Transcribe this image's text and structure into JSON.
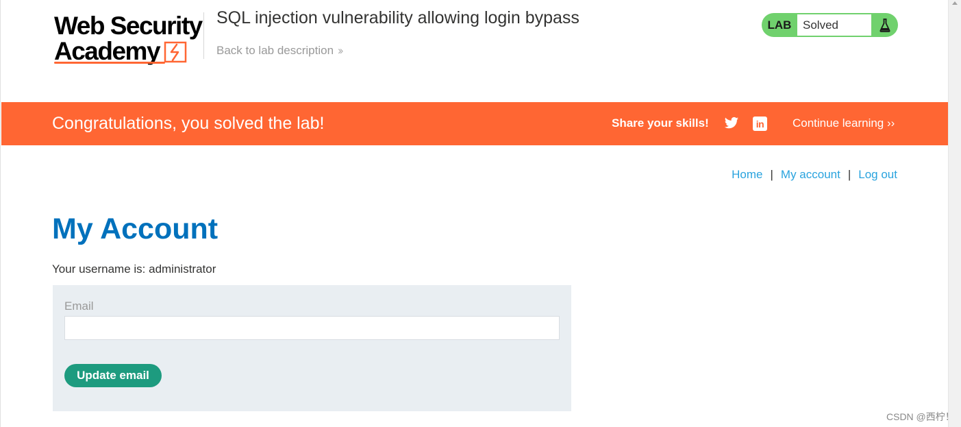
{
  "header": {
    "logo_line1": "Web Security",
    "logo_line2": "Academy",
    "lab_title": "SQL injection vulnerability allowing login bypass",
    "back_link": "Back to lab description",
    "lab_status": {
      "tag": "LAB",
      "state": "Solved"
    }
  },
  "banner": {
    "message": "Congratulations, you solved the lab!",
    "share": "Share your skills!",
    "continue": "Continue learning",
    "icons": [
      "twitter-icon",
      "linkedin-icon"
    ],
    "color": "#ff6633"
  },
  "nav": {
    "home": "Home",
    "my_account": "My account",
    "log_out": "Log out",
    "separator": "|"
  },
  "main": {
    "title": "My Account",
    "username_line": "Your username is: administrator",
    "email_label": "Email",
    "email_value": "",
    "update_button": "Update email"
  },
  "watermark": "CSDN @西柠！",
  "colors": {
    "accent_orange": "#ff6633",
    "title_blue": "#0071bc",
    "link_blue": "#29a3de",
    "lab_green": "#70d16d",
    "button_green": "#1d9b7f"
  }
}
